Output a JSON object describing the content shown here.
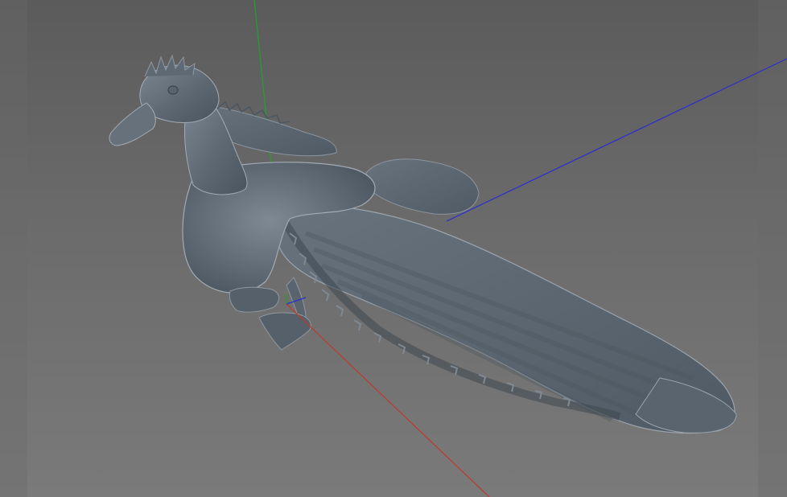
{
  "viewport": {
    "background_top": "#5b5b5b",
    "background_bottom": "#7a7a7a",
    "object": "duck-3d-model",
    "object_color": "#5f6b77",
    "axes": {
      "x_color": "#c0392b",
      "y_color": "#1fa32a",
      "z_color": "#2a2ed0"
    }
  }
}
